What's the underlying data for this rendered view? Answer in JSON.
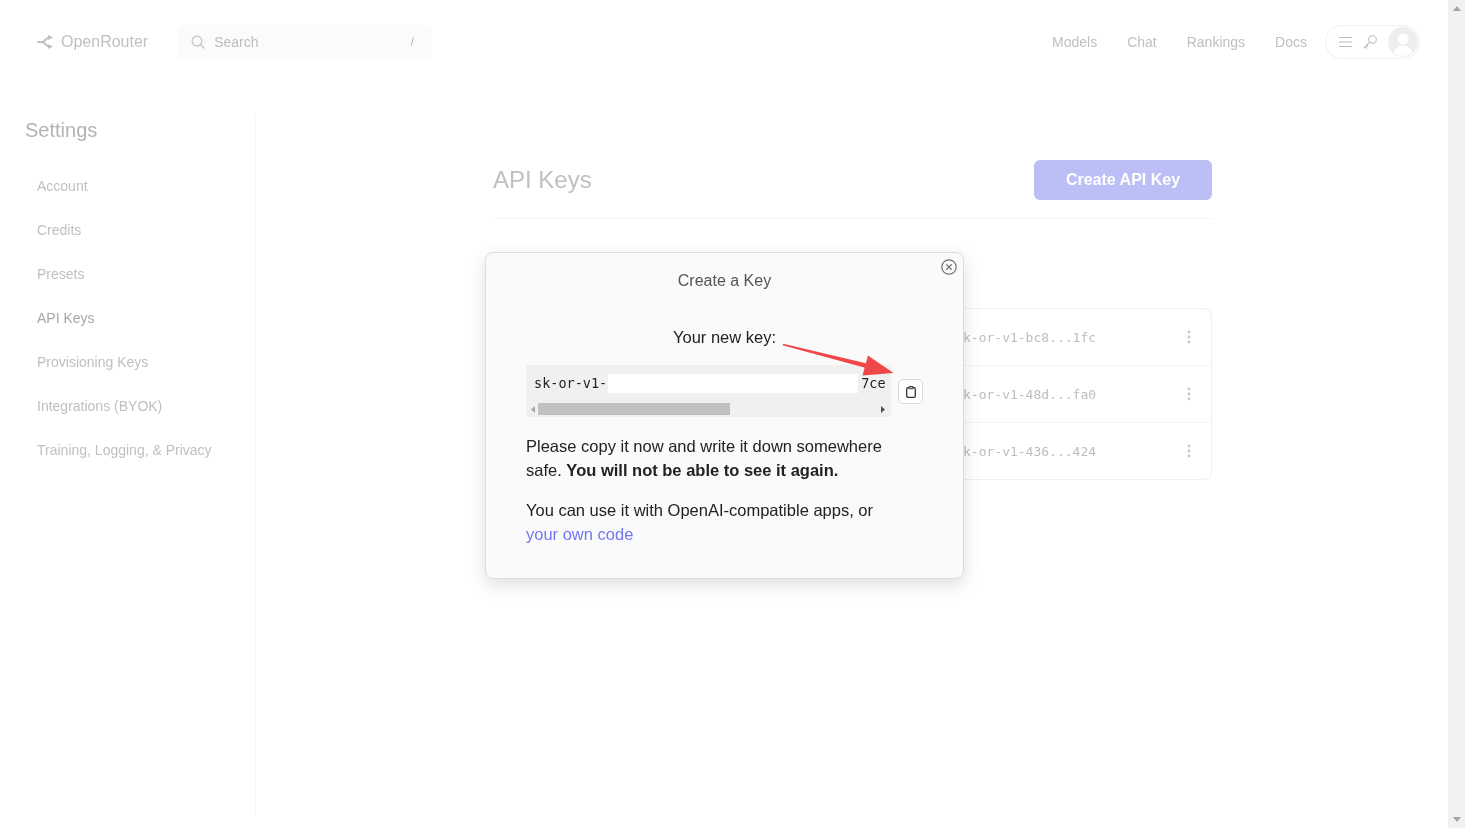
{
  "navbar": {
    "brand": "OpenRouter",
    "search": {
      "placeholder": "Search",
      "shortcut": "/"
    },
    "links": [
      {
        "label": "Models"
      },
      {
        "label": "Chat"
      },
      {
        "label": "Rankings"
      },
      {
        "label": "Docs"
      }
    ]
  },
  "sidebar": {
    "title": "Settings",
    "items": [
      {
        "label": "Account",
        "selected": false
      },
      {
        "label": "Credits",
        "selected": false
      },
      {
        "label": "Presets",
        "selected": false
      },
      {
        "label": "API Keys",
        "selected": true
      },
      {
        "label": "Provisioning Keys",
        "selected": false
      },
      {
        "label": "Integrations (BYOK)",
        "selected": false
      },
      {
        "label": "Training, Logging, & Privacy",
        "selected": false
      }
    ]
  },
  "main": {
    "title": "API Keys",
    "create_button": "Create API Key",
    "keys": [
      {
        "key": "k-or-v1-bc8...1fc"
      },
      {
        "key": "k-or-v1-48d...fa0"
      },
      {
        "key": "k-or-v1-436...424"
      }
    ]
  },
  "dialog": {
    "title": "Create a Key",
    "key_label": "Your new key:",
    "key": {
      "prefix": "sk-or-v1-",
      "suffix": "7ce"
    },
    "warning": "Please copy it now and write it down somewhere safe. **You will not be able to see it again.**",
    "usage": "You can use it with OpenAI-compatible apps, or",
    "link": "your own code"
  }
}
